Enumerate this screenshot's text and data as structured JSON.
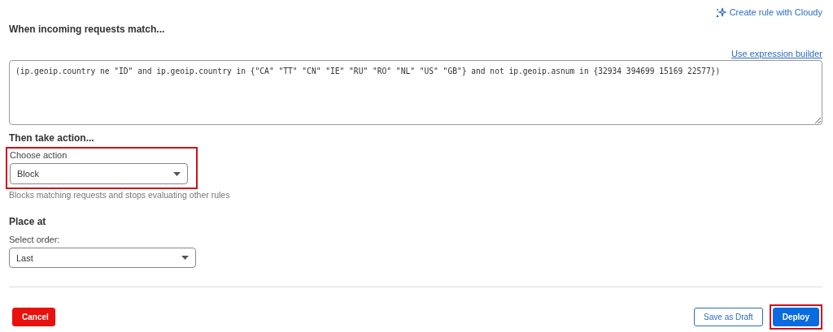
{
  "cloudy_link": {
    "label": "Create rule with Cloudy"
  },
  "match": {
    "heading": "When incoming requests match...",
    "builder_link": "Use expression builder",
    "expression": "(ip.geoip.country ne \"ID\" and ip.geoip.country in {\"CA\" \"TT\" \"CN\" \"IE\" \"RU\" \"RO\" \"NL\" \"US\" \"GB\"} and not ip.geoip.asnum in {32934 394699 15169 22577})"
  },
  "action": {
    "heading": "Then take action...",
    "label": "Choose action",
    "value": "Block",
    "highlighted": true,
    "help": "Blocks matching requests and stops evaluating other rules"
  },
  "place": {
    "heading": "Place at",
    "label": "Select order:",
    "value": "Last"
  },
  "buttons": [
    {
      "label": "Cancel",
      "kind": "danger",
      "highlighted": false
    },
    {
      "label": "Save as Draft",
      "kind": "outline",
      "highlighted": false
    },
    {
      "label": "Deploy",
      "kind": "primary",
      "highlighted": true
    }
  ]
}
